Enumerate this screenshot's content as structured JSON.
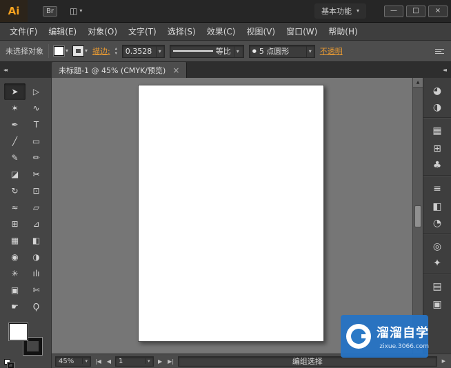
{
  "colors": {
    "accent_orange": "#e89a33",
    "watermark_blue": "#2a79c6",
    "canvas_gray": "#767676"
  },
  "window": {
    "logo": "Ai",
    "bridge": "Br",
    "workspace": "基本功能",
    "minimize": "—",
    "maximize": "□",
    "close": "×"
  },
  "icons": {
    "caret": "▾",
    "arrange": "◫",
    "spin_up": "▴",
    "spin_down": "▾",
    "scroll_up": "▲",
    "scroll_down": "▼",
    "collapse": "◂◂",
    "status_expand": "▶",
    "nav_first": "|◀",
    "nav_prev": "◀",
    "nav_next": "▶",
    "nav_last": "▶|"
  },
  "menubar": {
    "items": [
      {
        "name": "menu-item-file",
        "label": "文件(F)"
      },
      {
        "name": "menu-item-edit",
        "label": "编辑(E)"
      },
      {
        "name": "menu-item-object",
        "label": "对象(O)"
      },
      {
        "name": "menu-item-type",
        "label": "文字(T)"
      },
      {
        "name": "menu-item-select",
        "label": "选择(S)"
      },
      {
        "name": "menu-item-effect",
        "label": "效果(C)"
      },
      {
        "name": "menu-item-view",
        "label": "视图(V)"
      },
      {
        "name": "menu-item-window",
        "label": "窗口(W)"
      },
      {
        "name": "menu-item-help",
        "label": "帮助(H)"
      }
    ]
  },
  "controlbar": {
    "selection_status": "未选择对象",
    "stroke_link": "描边:",
    "stroke_weight": "0.3528",
    "profile_label": "等比",
    "brush_bullet": "●",
    "brush_label": "5 点圆形",
    "opacity_link": "不透明"
  },
  "document_tab": {
    "title": "未标题-1 @ 45% (CMYK/预览)",
    "close": "×"
  },
  "toolbox": {
    "tools": [
      {
        "name": "selection-tool",
        "glyph": "➤"
      },
      {
        "name": "direct-selection-tool",
        "glyph": "▷"
      },
      {
        "name": "magic-wand-tool",
        "glyph": "✶"
      },
      {
        "name": "lasso-tool",
        "glyph": "∿"
      },
      {
        "name": "pen-tool",
        "glyph": "✒"
      },
      {
        "name": "type-tool",
        "glyph": "T"
      },
      {
        "name": "line-segment-tool",
        "glyph": "╱"
      },
      {
        "name": "rectangle-tool",
        "glyph": "▭"
      },
      {
        "name": "paintbrush-tool",
        "glyph": "✎"
      },
      {
        "name": "pencil-tool",
        "glyph": "✏"
      },
      {
        "name": "eraser-tool",
        "glyph": "◪"
      },
      {
        "name": "scissors-tool",
        "glyph": "✂"
      },
      {
        "name": "rotate-tool",
        "glyph": "↻"
      },
      {
        "name": "scale-tool",
        "glyph": "⊡"
      },
      {
        "name": "width-tool",
        "glyph": "≈"
      },
      {
        "name": "free-transform-tool",
        "glyph": "▱"
      },
      {
        "name": "shape-builder-tool",
        "glyph": "⊞"
      },
      {
        "name": "perspective-grid-tool",
        "glyph": "⊿"
      },
      {
        "name": "mesh-tool",
        "glyph": "▦"
      },
      {
        "name": "gradient-tool",
        "glyph": "◧"
      },
      {
        "name": "eyedropper-tool",
        "glyph": "◉"
      },
      {
        "name": "blend-tool",
        "glyph": "◑"
      },
      {
        "name": "symbol-sprayer-tool",
        "glyph": "✳"
      },
      {
        "name": "column-graph-tool",
        "glyph": "ılı"
      },
      {
        "name": "artboard-tool",
        "glyph": "▣"
      },
      {
        "name": "slice-tool",
        "glyph": "✄"
      },
      {
        "name": "hand-tool",
        "glyph": "☛"
      },
      {
        "name": "zoom-tool",
        "glyph": "Ϙ"
      }
    ]
  },
  "right_panels": {
    "icons": [
      {
        "name": "color-panel-icon",
        "glyph": "◕"
      },
      {
        "name": "color-guide-panel-icon",
        "glyph": "◑"
      },
      {
        "name": "swatches-panel-icon",
        "glyph": "▦"
      },
      {
        "name": "brushes-panel-icon",
        "glyph": "⊞"
      },
      {
        "name": "symbols-panel-icon",
        "glyph": "♣"
      },
      {
        "name": "stroke-panel-icon",
        "glyph": "≡"
      },
      {
        "name": "gradient-panel-icon",
        "glyph": "◧"
      },
      {
        "name": "transparency-panel-icon",
        "glyph": "◔"
      },
      {
        "name": "appearance-panel-icon",
        "glyph": "◎"
      },
      {
        "name": "graphic-styles-panel-icon",
        "glyph": "✦"
      },
      {
        "name": "layers-panel-icon",
        "glyph": "▤"
      },
      {
        "name": "artboards-panel-icon",
        "glyph": "▣"
      }
    ]
  },
  "statusbar": {
    "zoom_value": "45%",
    "page_value": "1",
    "status_text": "编组选择"
  },
  "watermark": {
    "title": "溜溜自学",
    "url": "zixue.3066.com"
  }
}
